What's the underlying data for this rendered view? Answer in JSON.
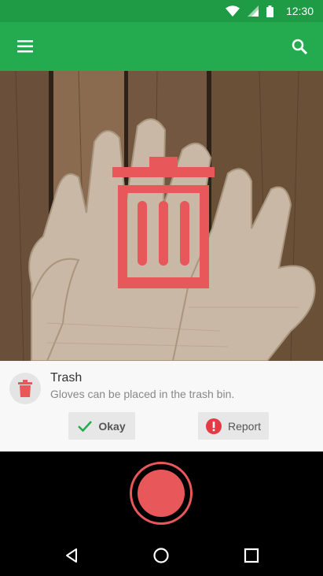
{
  "status_bar": {
    "time": "12:30",
    "icons": [
      "wifi-icon",
      "cell-signal-icon",
      "battery-icon"
    ]
  },
  "app_bar": {
    "menu_icon": "hamburger-icon",
    "search_icon": "search-icon",
    "color": "#24ab4f"
  },
  "photo": {
    "subject": "knit-gloves",
    "overlay_icon": "trash-can-icon",
    "overlay_color": "#e8575a"
  },
  "result": {
    "title": "Trash",
    "description": "Gloves can be placed in the trash bin.",
    "icon": "trash-can-icon"
  },
  "actions": {
    "okay_label": "Okay",
    "report_label": "Report"
  },
  "camera": {
    "shutter_icon": "shutter-button",
    "accent": "#e8575a"
  },
  "nav": {
    "back": "back-icon",
    "home": "home-icon",
    "recents": "recents-icon"
  }
}
